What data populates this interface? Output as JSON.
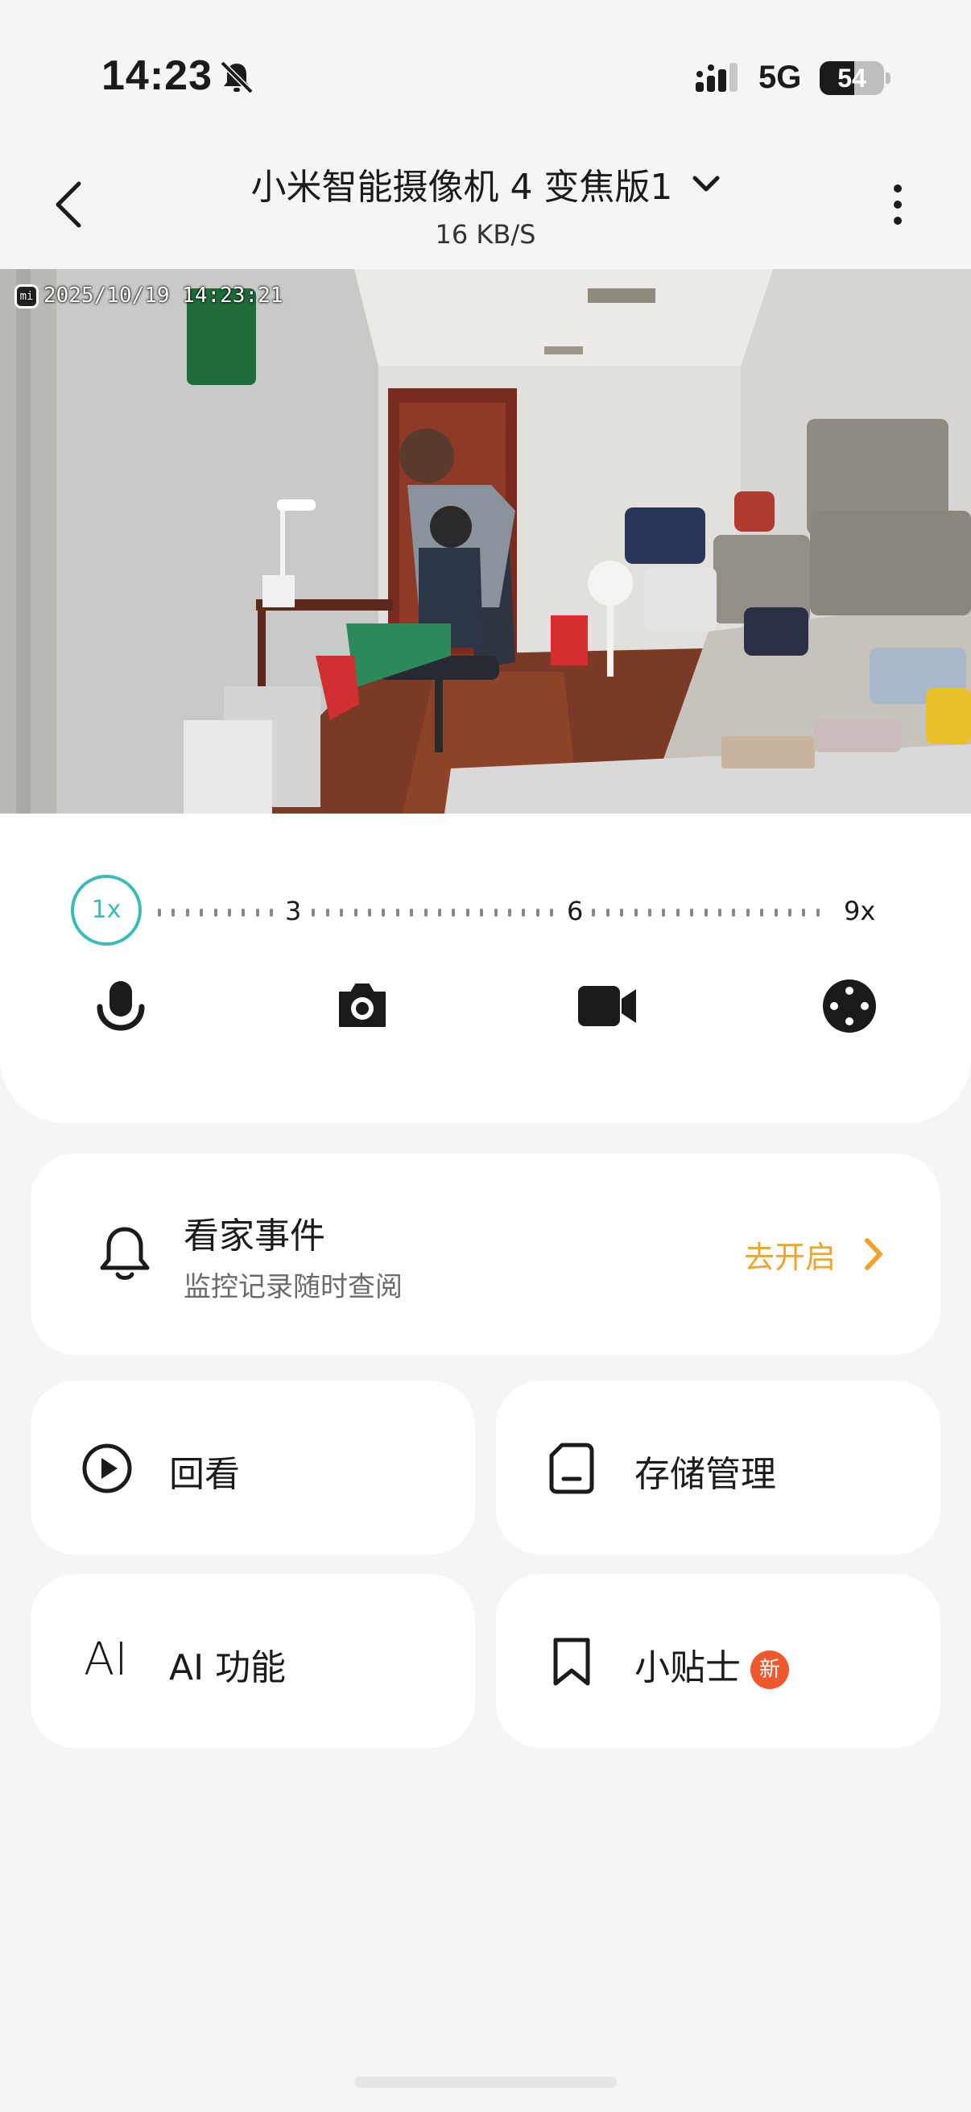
{
  "status_bar": {
    "time": "14:23",
    "network": "5G",
    "battery": "54",
    "battery_level": 0.54
  },
  "header": {
    "title": "小米智能摄像机 4 变焦版1",
    "speed": "16 KB/S"
  },
  "video": {
    "timestamp": "2025/10/19  14:23:21",
    "logo_text": "mi"
  },
  "zoom": {
    "current": "1x",
    "marks": [
      "3",
      "6",
      "9x"
    ]
  },
  "controls": [
    "microphone-icon",
    "camera-icon",
    "video-record-icon",
    "joystick-icon"
  ],
  "events_card": {
    "title": "看家事件",
    "subtitle": "监控记录随时查阅",
    "action": "去开启"
  },
  "tiles": {
    "playback": "回看",
    "storage": "存储管理",
    "ai": "AI 功能",
    "ai_icon": "AI",
    "tips": "小贴士",
    "tips_badge": "新"
  },
  "colors": {
    "accent_teal": "#3bbcb8",
    "accent_orange": "#f0a429",
    "badge_red": "#f0582d"
  }
}
